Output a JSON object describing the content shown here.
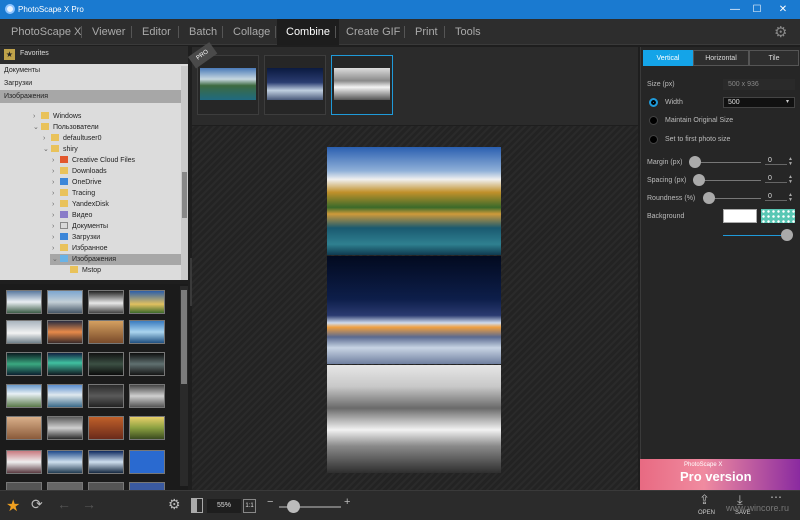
{
  "window": {
    "title": "PhotoScape X Pro",
    "min_glyph": "—",
    "max_glyph": "☐",
    "close_glyph": "✕"
  },
  "menu": {
    "tabs": [
      "PhotoScape X",
      "Viewer",
      "Editor",
      "Batch",
      "Collage",
      "Combine",
      "Create GIF",
      "Print",
      "Tools"
    ],
    "active": "Combine",
    "settings_icon": "gear-icon"
  },
  "favorites": {
    "header": "Favorites",
    "items": [
      "Документы",
      "Загрузки",
      "Изображения"
    ],
    "selected": "Изображения"
  },
  "tree": {
    "nodes": [
      {
        "label": "Windows",
        "exp": "›"
      },
      {
        "label": "Пользователи",
        "exp": "⌄"
      },
      {
        "label": "defaultuser0",
        "exp": "›"
      },
      {
        "label": "shiry",
        "exp": "⌄"
      },
      {
        "label": "Creative Cloud Files",
        "exp": "›"
      },
      {
        "label": "Downloads",
        "exp": "›"
      },
      {
        "label": "OneDrive",
        "exp": "›"
      },
      {
        "label": "Tracing",
        "exp": "›"
      },
      {
        "label": "YandexDisk",
        "exp": "›"
      },
      {
        "label": "Видео",
        "exp": "›"
      },
      {
        "label": "Документы",
        "exp": "›"
      },
      {
        "label": "Загрузки",
        "exp": "›"
      },
      {
        "label": "Избранное",
        "exp": "›"
      },
      {
        "label": "Изображения",
        "exp": "⌄"
      },
      {
        "label": "Mstop",
        "exp": ""
      }
    ],
    "selected": "Изображения"
  },
  "combine": {
    "pro_badge": "PRO",
    "strip_count": 3,
    "selected_strip": 3
  },
  "panel": {
    "tabs": [
      "Vertical",
      "Horizontal",
      "Tile"
    ],
    "active_tab": "Vertical",
    "size_label": "Size (px)",
    "size_value": "500 x 936",
    "width_label": "Width",
    "width_value": "500",
    "maintain_label": "Maintain Original Size",
    "set_first_label": "Set to first photo size",
    "margin_label": "Margin (px)",
    "margin_value": "0",
    "spacing_label": "Spacing (px)",
    "spacing_value": "0",
    "roundness_label": "Roundness (%)",
    "roundness_value": "0",
    "background_label": "Background"
  },
  "ad": {
    "small": "PhotoScape X",
    "big": "Pro version"
  },
  "bottom": {
    "zoom": "55%",
    "fit_label": "1:1",
    "zoom_minus": "−",
    "zoom_plus": "+",
    "open_label": "OPEN",
    "save_label": "SAVE",
    "watermark": "www.wincore.ru"
  },
  "colors": {
    "accent": "#1f9ad9",
    "titlebar": "#1a7ad0",
    "tab_active": "#14a4e8"
  }
}
